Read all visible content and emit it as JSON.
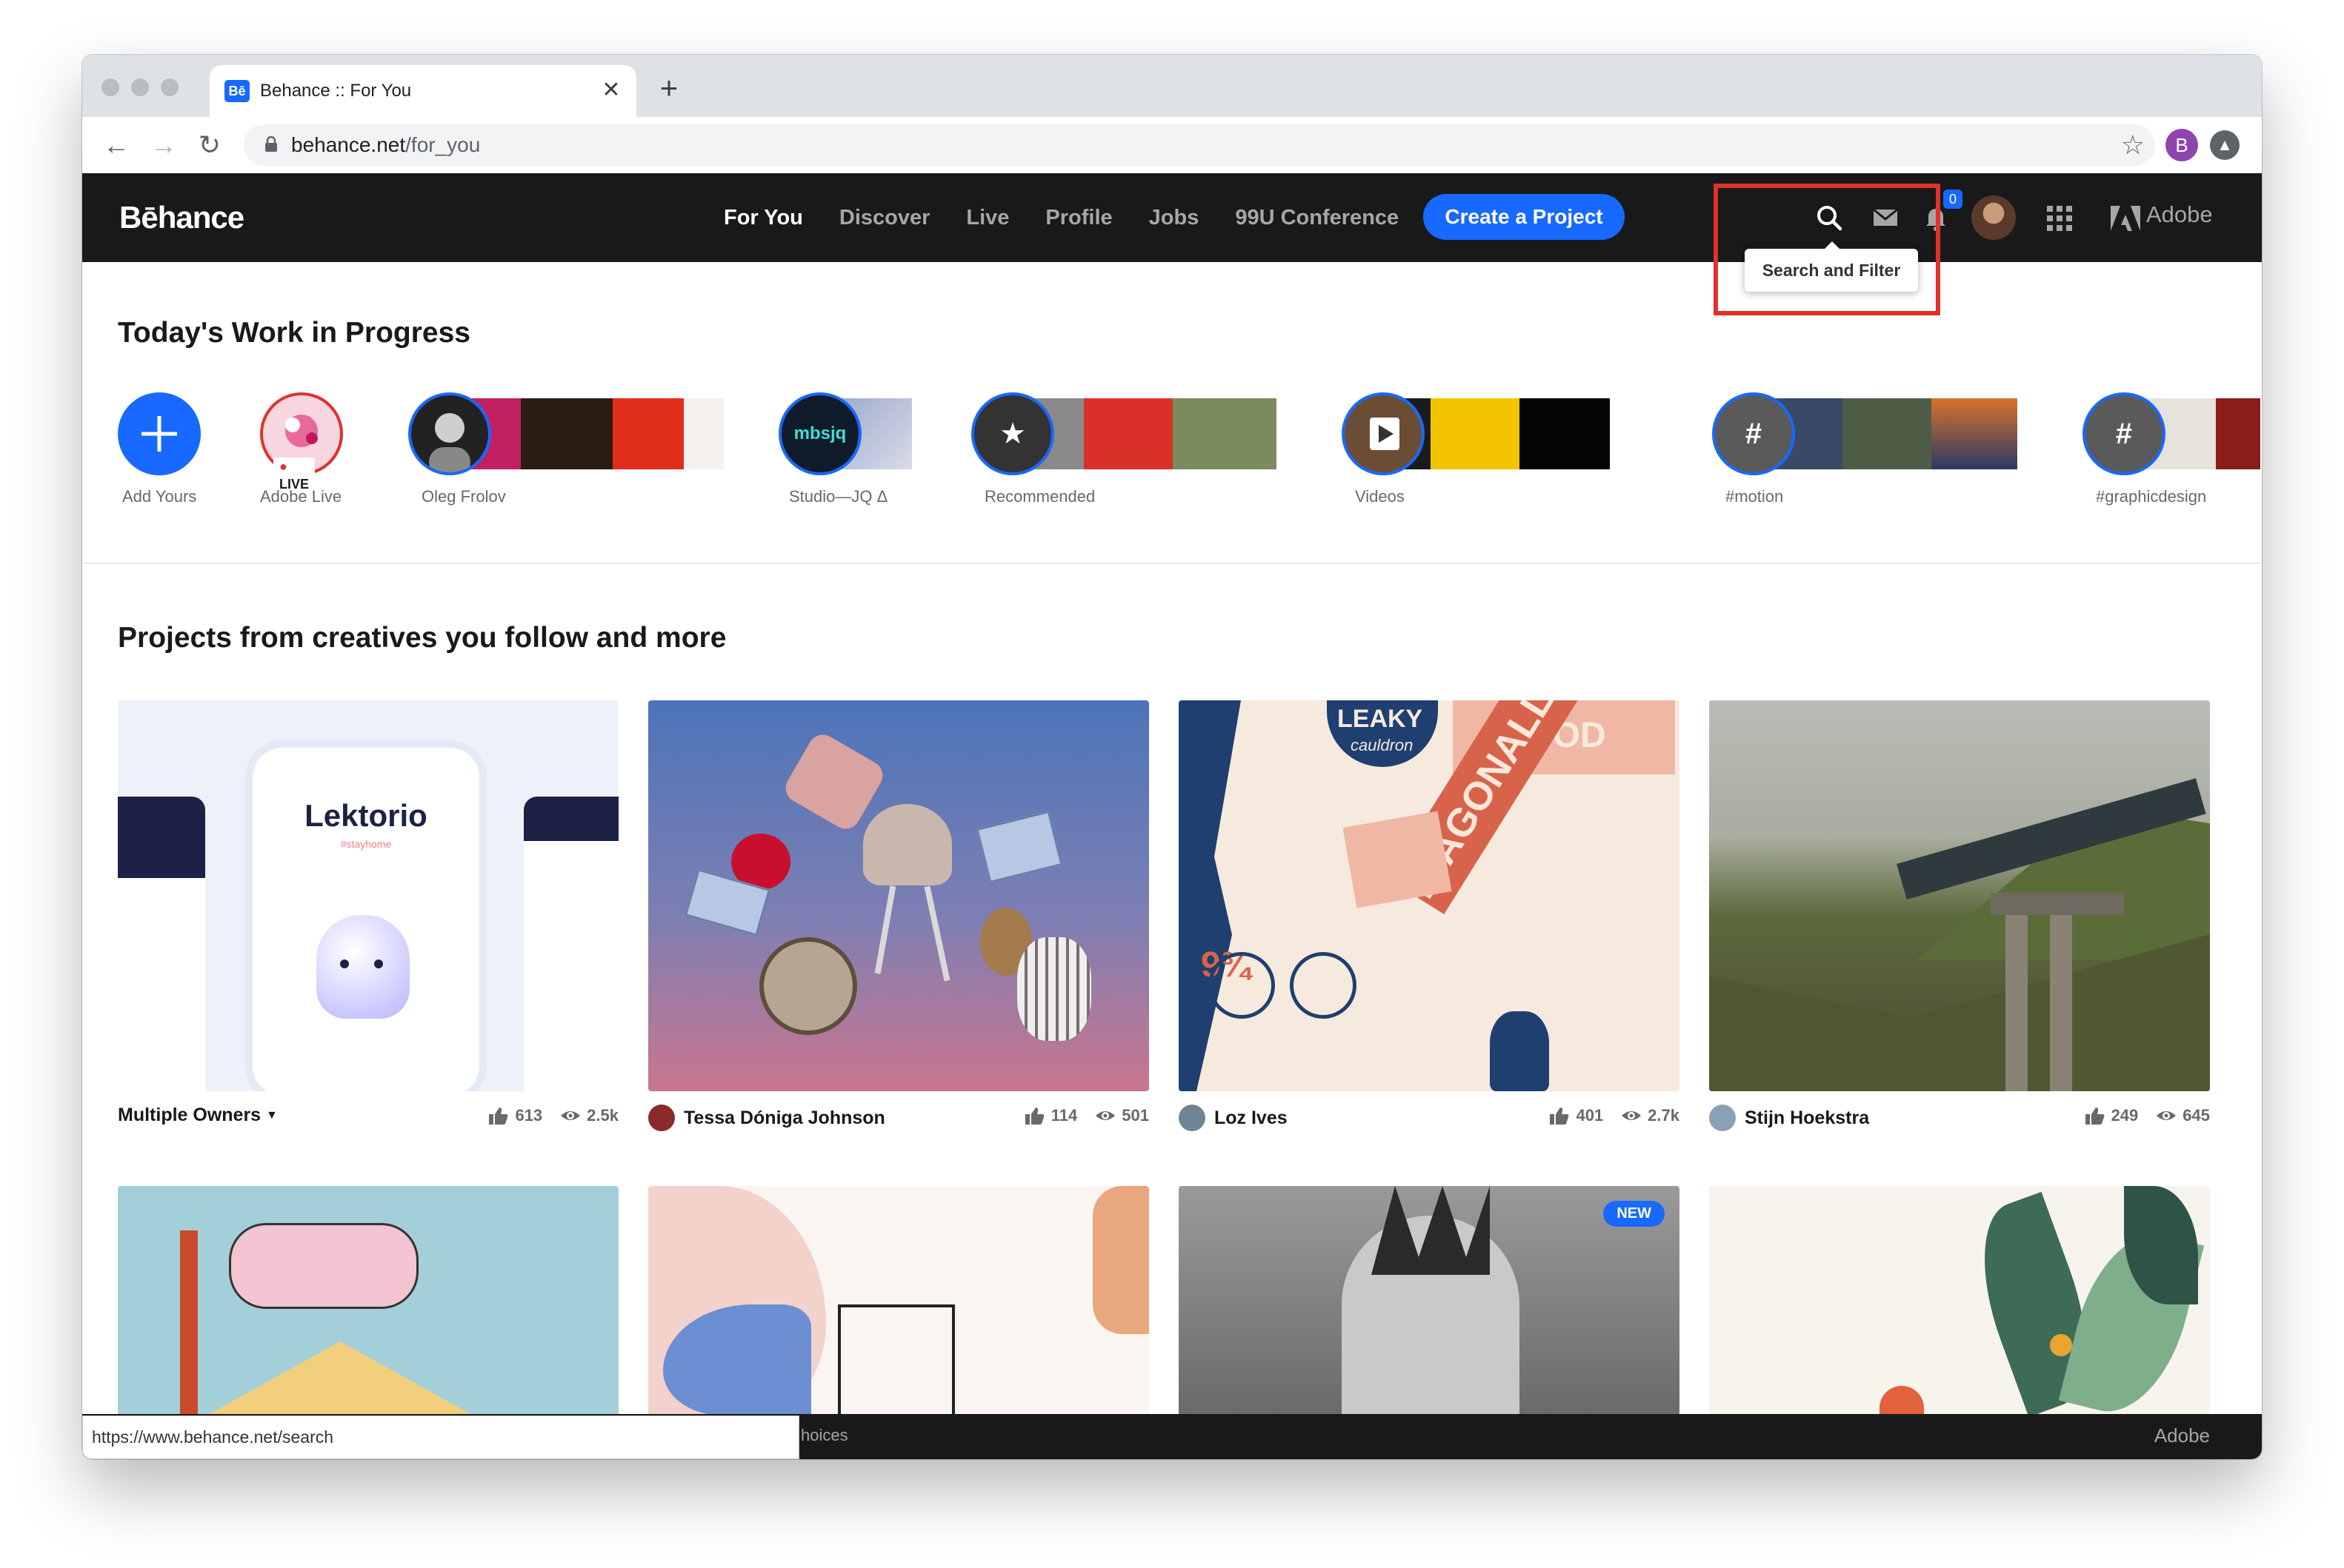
{
  "browser": {
    "tab_title": "Behance :: For You",
    "tab_favicon": "Bē",
    "close_glyph": "✕",
    "new_tab_glyph": "+",
    "url_host": "behance.net",
    "url_path": "/for_you",
    "profile_initial": "B"
  },
  "header": {
    "logo": "Bēhance",
    "nav": [
      "For You",
      "Discover",
      "Live",
      "Profile",
      "Jobs",
      "99U Conference"
    ],
    "active_nav": "For You",
    "create_label": "Create a Project",
    "notif_count": "0",
    "adobe_label": "Adobe",
    "tooltip": "Search and Filter"
  },
  "wip": {
    "title": "Today's Work in Progress",
    "items": [
      {
        "label": "Add Yours"
      },
      {
        "label": "Adobe Live",
        "badge": "LIVE"
      },
      {
        "label": "Oleg Frolov"
      },
      {
        "label": "Studio—JQ Δ",
        "avatar_text": "mbsjq"
      },
      {
        "label": "Recommended"
      },
      {
        "label": "Videos"
      },
      {
        "label": "#motion"
      },
      {
        "label": "#graphicdesign"
      }
    ]
  },
  "projects": {
    "title": "Projects from creatives you follow and more",
    "cards": [
      {
        "owner": "Multiple Owners",
        "likes": "613",
        "views": "2.5k",
        "thumb_text": "Lektorio",
        "thumb_sub": "#stayhome"
      },
      {
        "owner": "Tessa Dóniga Johnson",
        "likes": "114",
        "views": "501"
      },
      {
        "owner": "Loz Ives",
        "likes": "401",
        "views": "2.7k",
        "thumb_words": [
          "LEAKY",
          "cauldron",
          "DIAGONALLY",
          "GOOD",
          "9¾"
        ]
      },
      {
        "owner": "Stijn Hoekstra",
        "likes": "249",
        "views": "645"
      }
    ],
    "row2_badge": "NEW"
  },
  "footer": {
    "text": "hoices",
    "adobe": "Adobe",
    "status_url": "https://www.behance.net/search"
  },
  "colors": {
    "brand_blue": "#1769ff",
    "header_bg": "#191919",
    "highlight_red": "#e0312c"
  }
}
